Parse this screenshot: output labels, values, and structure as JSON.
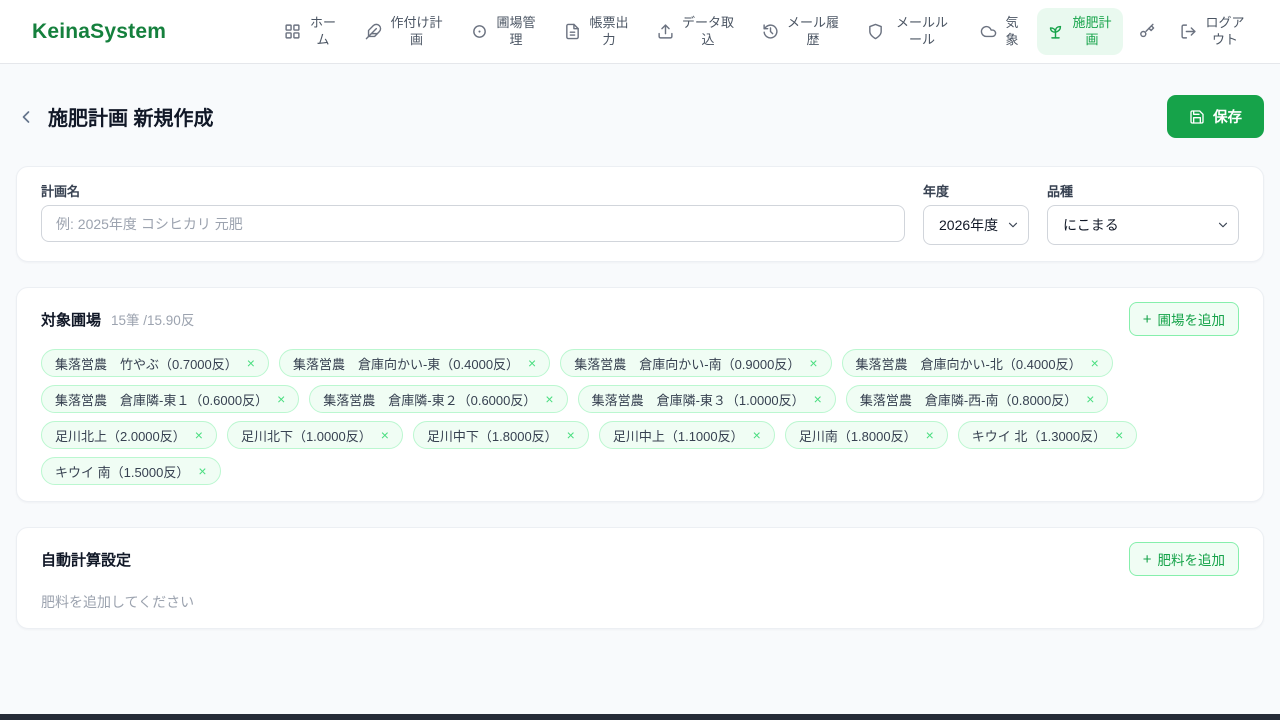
{
  "colors": {
    "accent_green": "#16a34a",
    "logo_green": "#15803d",
    "active_nav_bg": "#e9f9ef",
    "chip_bg": "#f0fdf4",
    "chip_border": "#bbf7d0",
    "page_bg": "#f8fafc"
  },
  "icons": {
    "plus-icon": "+",
    "close-icon": "×"
  },
  "header": {
    "logo": "KeinaSystem",
    "nav": [
      {
        "label": "ホーム",
        "icon": "grid-icon"
      },
      {
        "label": "作付け計画",
        "icon": "feather-icon"
      },
      {
        "label": "圃場管理",
        "icon": "map-pin-icon"
      },
      {
        "label": "帳票出力",
        "icon": "document-icon"
      },
      {
        "label": "データ取込",
        "icon": "upload-icon"
      },
      {
        "label": "メール履歴",
        "icon": "history-clock-icon"
      },
      {
        "label": "メールルール",
        "icon": "shield-icon"
      },
      {
        "label": "気象",
        "icon": "cloud-icon"
      },
      {
        "label": "施肥計画",
        "icon": "sprout-icon",
        "active": true
      }
    ],
    "logout_label": "ログアウト"
  },
  "page": {
    "title": "施肥計画 新規作成",
    "save_label": "保存"
  },
  "form": {
    "name_label": "計画名",
    "name_placeholder": "例: 2025年度 コシヒカリ 元肥",
    "year_label": "年度",
    "year_value": "2026年度",
    "variety_label": "品種",
    "variety_value": "にこまる"
  },
  "fields": {
    "title": "対象圃場",
    "summary": "15筆 /15.90反",
    "add_label": "圃場を追加",
    "tags": [
      "集落営農　竹やぶ（0.7000反）",
      "集落営農　倉庫向かい-東（0.4000反）",
      "集落営農　倉庫向かい-南（0.9000反）",
      "集落営農　倉庫向かい-北（0.4000反）",
      "集落営農　倉庫隣-東１（0.6000反）",
      "集落営農　倉庫隣-東２（0.6000反）",
      "集落営農　倉庫隣-東３（1.0000反）",
      "集落営農　倉庫隣-西-南（0.8000反）",
      "足川北上（2.0000反）",
      "足川北下（1.0000反）",
      "足川中下（1.8000反）",
      "足川中上（1.1000反）",
      "足川南（1.8000反）",
      "キウイ 北（1.3000反）",
      "キウイ 南（1.5000反）"
    ]
  },
  "autocalc": {
    "title": "自動計算設定",
    "add_label": "肥料を追加",
    "empty_text": "肥料を追加してください"
  }
}
